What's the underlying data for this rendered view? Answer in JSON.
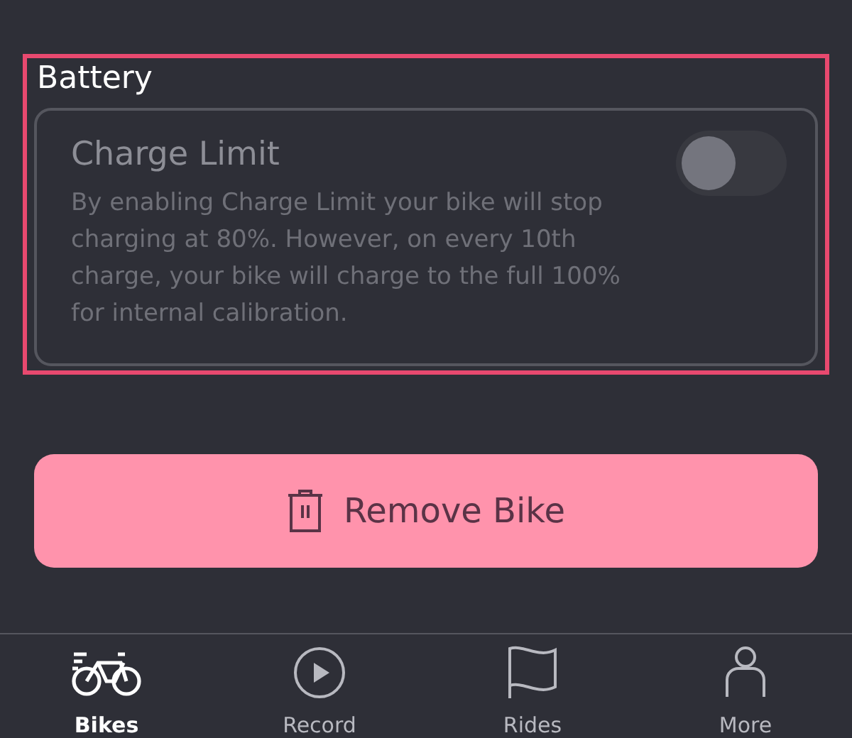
{
  "section": {
    "title": "Battery",
    "highlighted": true
  },
  "setting": {
    "title": "Charge Limit",
    "description": "By enabling Charge Limit your bike will stop charging at 80%. However, on every 10th charge, your bike will charge to the full 100% for internal calibration.",
    "on": false
  },
  "remove_button": {
    "label": "Remove Bike"
  },
  "tabs": [
    {
      "label": "Bikes",
      "kind": "bike",
      "selected": true
    },
    {
      "label": "Record",
      "kind": "record",
      "selected": false
    },
    {
      "label": "Rides",
      "kind": "flag",
      "selected": false
    },
    {
      "label": "More",
      "kind": "person",
      "selected": false
    }
  ]
}
